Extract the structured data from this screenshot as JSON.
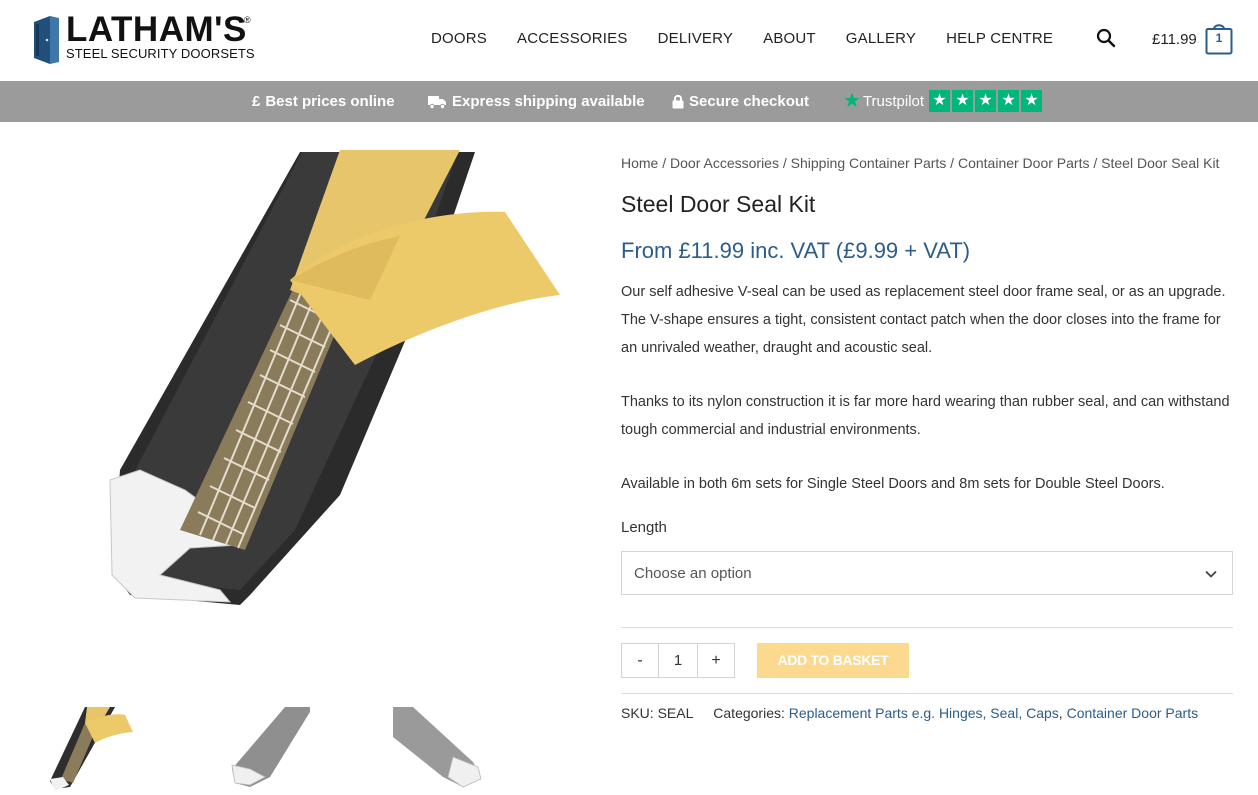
{
  "brand": {
    "name": "LATHAM'S",
    "registered_mark": "®",
    "tagline": "STEEL SECURITY DOORSETS",
    "color": "#1f4f7a"
  },
  "nav": {
    "items": [
      {
        "label": "DOORS"
      },
      {
        "label": "ACCESSORIES"
      },
      {
        "label": "DELIVERY"
      },
      {
        "label": "ABOUT"
      },
      {
        "label": "GALLERY"
      },
      {
        "label": "HELP CENTRE"
      }
    ]
  },
  "cart": {
    "total": "£11.99",
    "count": "1"
  },
  "promo": {
    "best_prices": "Best prices online",
    "best_prices_icon_text": "£",
    "shipping": "Express shipping available",
    "secure": "Secure checkout",
    "trustpilot": "Trustpilot",
    "trustpilot_rating": 5,
    "bar_color": "#9b9b9b",
    "trustpilot_color": "#00b67a"
  },
  "product": {
    "breadcrumb": [
      {
        "label": "Home"
      },
      {
        "label": "Door Accessories"
      },
      {
        "label": "Shipping Container Parts"
      },
      {
        "label": "Container Door Parts"
      },
      {
        "label": "Steel Door Seal Kit"
      }
    ],
    "breadcrumb_separator": " / ",
    "title": "Steel Door Seal Kit",
    "price": "From £11.99 inc. VAT (£9.99 + VAT)",
    "description": [
      "Our self adhesive V-seal can be used as replacement steel door frame seal, or as an upgrade. The V-shape ensures a tight, consistent contact patch when the door closes into the frame for an unrivaled weather, draught and acoustic seal.",
      "Thanks to its nylon construction it is far more hard wearing than rubber seal, and can withstand tough commercial and industrial environments.",
      "Available in both 6m sets for Single Steel Doors and 8m sets for Double Steel Doors."
    ],
    "length_label": "Length",
    "length_select_value": "Choose an option",
    "quantity": "1",
    "qty_minus": "-",
    "qty_plus": "+",
    "add_to_basket": "ADD TO BASKET",
    "add_button_color": "#fbd98e",
    "sku_label": "SKU:",
    "sku": "SEAL",
    "categories_label": "Categories:",
    "categories": [
      {
        "label": "Replacement Parts e.g. Hinges, Seal, Caps"
      },
      {
        "label": "Container Door Parts"
      }
    ],
    "categories_separator": ", ",
    "price_color": "#2c5d8a"
  }
}
